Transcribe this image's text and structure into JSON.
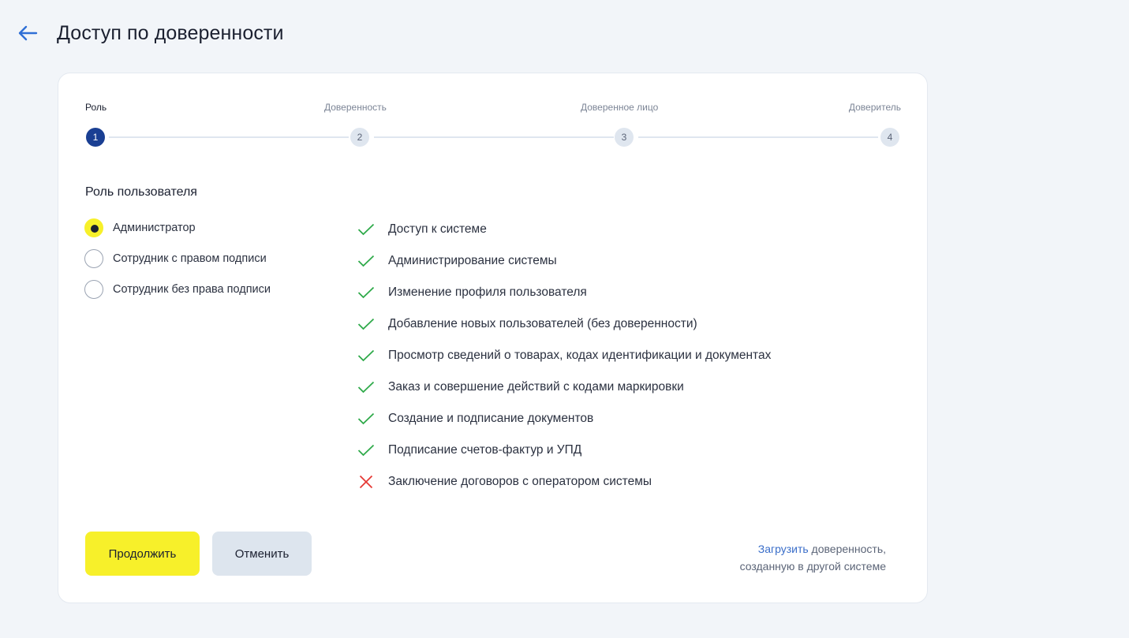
{
  "page": {
    "title": "Доступ по доверенности",
    "back_icon": "arrow-left-icon"
  },
  "stepper": {
    "steps": [
      {
        "label": "Роль",
        "number": "1",
        "active": true
      },
      {
        "label": "Доверенность",
        "number": "2",
        "active": false
      },
      {
        "label": "Доверенное лицо",
        "number": "3",
        "active": false
      },
      {
        "label": "Доверитель",
        "number": "4",
        "active": false
      }
    ]
  },
  "role_section": {
    "title": "Роль пользователя",
    "options": [
      {
        "label": "Администратор",
        "checked": true
      },
      {
        "label": "Сотрудник с правом подписи",
        "checked": false
      },
      {
        "label": "Сотрудник без права подписи",
        "checked": false
      }
    ]
  },
  "permissions": [
    {
      "text": "Доступ к системе",
      "allowed": true
    },
    {
      "text": "Администрирование системы",
      "allowed": true
    },
    {
      "text": "Изменение профиля пользователя",
      "allowed": true
    },
    {
      "text": "Добавление новых пользователей (без доверенности)",
      "allowed": true
    },
    {
      "text": "Просмотр сведений о товарах, кодах идентификации и документах",
      "allowed": true
    },
    {
      "text": "Заказ и совершение действий с кодами маркировки",
      "allowed": true
    },
    {
      "text": "Создание и подписание документов",
      "allowed": true
    },
    {
      "text": "Подписание счетов-фактур и УПД",
      "allowed": true
    },
    {
      "text": "Заключение договоров с оператором системы",
      "allowed": false
    }
  ],
  "actions": {
    "continue_label": "Продолжить",
    "cancel_label": "Отменить"
  },
  "upload": {
    "link_text": "Загрузить",
    "text_rest_1": " доверенность,",
    "text_line_2": "созданную в другой системе"
  },
  "colors": {
    "accent_yellow": "#f7f02a",
    "step_active": "#1a3f93",
    "check_green": "#2faa4a",
    "cross_red": "#e53935",
    "link_blue": "#3a6ec9"
  }
}
